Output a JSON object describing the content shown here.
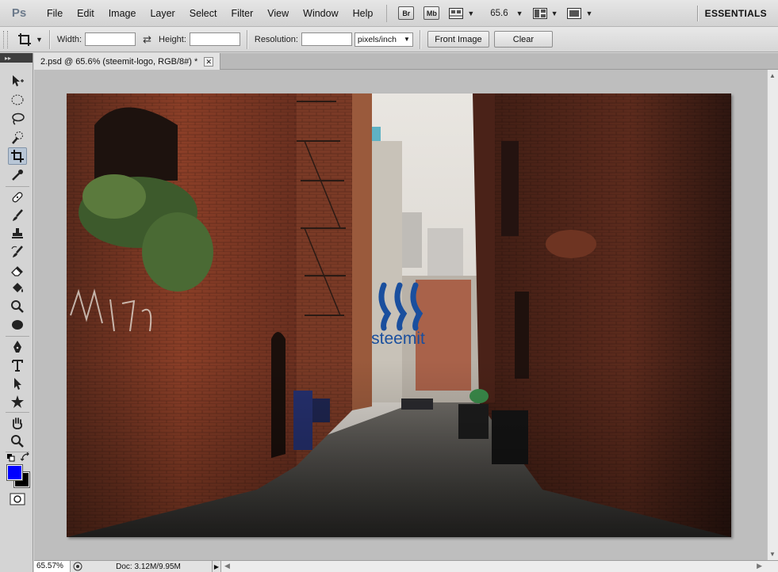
{
  "app": {
    "logo": "Ps",
    "workspace": "ESSENTIALS"
  },
  "menu": [
    "File",
    "Edit",
    "Image",
    "Layer",
    "Select",
    "Filter",
    "View",
    "Window",
    "Help"
  ],
  "appbar": {
    "bridge": "Br",
    "minibridge": "Mb",
    "zoom": "65.6"
  },
  "options": {
    "width_label": "Width:",
    "width_value": "",
    "height_label": "Height:",
    "height_value": "",
    "resolution_label": "Resolution:",
    "resolution_value": "",
    "units": "pixels/inch",
    "front_image": "Front Image",
    "clear": "Clear"
  },
  "document": {
    "tab_title": "2.psd @ 65.6% (steemit-logo, RGB/8#) *",
    "watermark": "steemit"
  },
  "colors": {
    "foreground": "#0000ff",
    "background": "#000000",
    "logo_blue": "#1a4f9e"
  },
  "status": {
    "zoom": "65.57%",
    "doc": "Doc: 3.12M/9.95M"
  }
}
